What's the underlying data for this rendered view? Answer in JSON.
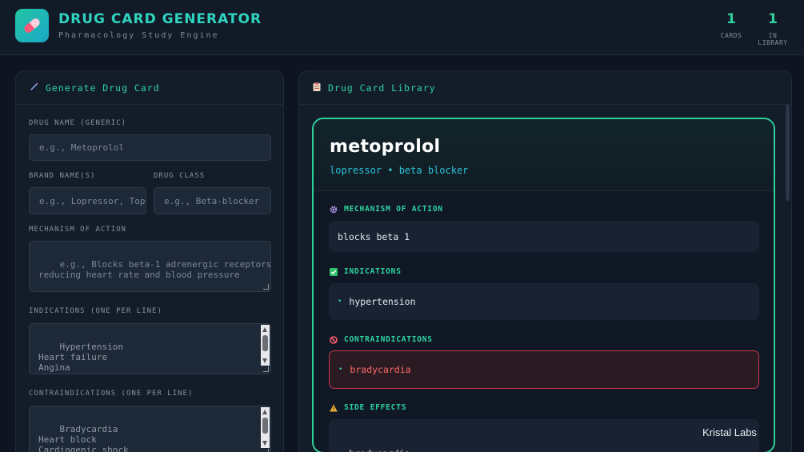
{
  "header": {
    "title": "DRUG CARD GENERATOR",
    "subtitle": "Pharmacology Study Engine",
    "stats": [
      {
        "value": "1",
        "label": "CARDS"
      },
      {
        "value": "1",
        "label": "IN LIBRARY"
      }
    ]
  },
  "generator": {
    "heading": "Generate Drug Card",
    "heading_icon": "pencil-icon",
    "fields": {
      "drug_name": {
        "label": "DRUG NAME (GENERIC)",
        "placeholder": "e.g., Metoprolol"
      },
      "brand_names": {
        "label": "BRAND NAME(S)",
        "placeholder": "e.g., Lopressor, Toprol"
      },
      "drug_class": {
        "label": "DRUG CLASS",
        "placeholder": "e.g., Beta-blocker"
      },
      "mechanism": {
        "label": "MECHANISM OF ACTION",
        "placeholder": "e.g., Blocks beta-1 adrenergic receptors,\nreducing heart rate and blood pressure"
      },
      "indications": {
        "label": "INDICATIONS (ONE PER LINE)",
        "value": "Hypertension\nHeart failure\nAngina\nPost-MI prophylaxis"
      },
      "contraindications": {
        "label": "CONTRAINDICATIONS (ONE PER LINE)",
        "value": "Bradycardia\nHeart block\nCardiogenic shock\nDecompensated HF"
      }
    }
  },
  "library": {
    "heading": "Drug Card Library",
    "heading_icon": "clipboard-icon",
    "card": {
      "name": "metoprolol",
      "subtitle": "lopressor • beta blocker",
      "sections": {
        "mechanism": {
          "title": "MECHANISM OF ACTION",
          "icon": "gear-icon",
          "text": "blocks beta 1"
        },
        "indications": {
          "title": "INDICATIONS",
          "icon": "checkbox-icon",
          "items": [
            "hypertension"
          ]
        },
        "contraindications": {
          "title": "CONTRAINDICATIONS",
          "icon": "prohibited-icon",
          "items": [
            "bradycardia"
          ]
        },
        "side_effects": {
          "title": "SIDE EFFECTS",
          "icon": "warning-icon",
          "items": [
            "bradycardia"
          ]
        }
      }
    }
  },
  "watermark": "Kristal Labs",
  "colors": {
    "accent": "#2fd4a0",
    "cyan": "#2dc2d8",
    "danger": "#c8354a",
    "background": "#0e1520"
  }
}
